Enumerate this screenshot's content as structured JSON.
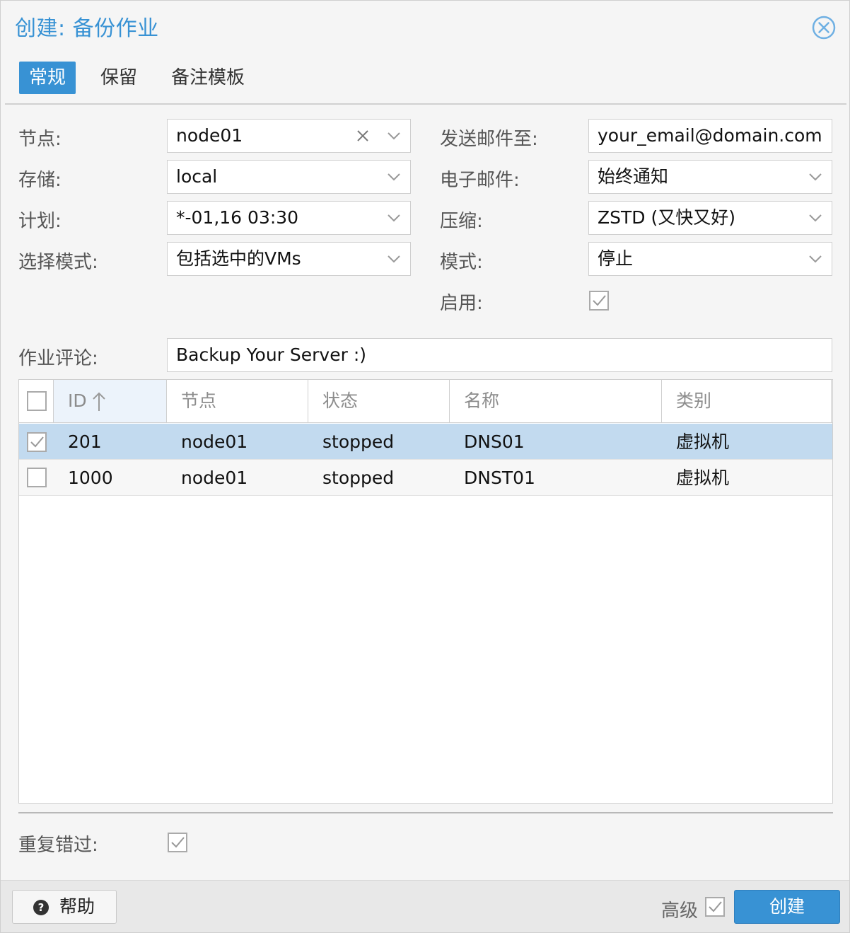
{
  "window": {
    "title": "创建: 备份作业"
  },
  "tabs": [
    {
      "label": "常规",
      "active": true
    },
    {
      "label": "保留",
      "active": false
    },
    {
      "label": "备注模板",
      "active": false
    }
  ],
  "form": {
    "node": {
      "label": "节点:",
      "value": "node01"
    },
    "storage": {
      "label": "存储:",
      "value": "local"
    },
    "schedule": {
      "label": "计划:",
      "value": "*-01,16 03:30"
    },
    "selection_mode": {
      "label": "选择模式:",
      "value": "包括选中的VMs"
    },
    "send_email_to": {
      "label": "发送邮件至:",
      "value": "your_email@domain.com"
    },
    "email": {
      "label": "电子邮件:",
      "value": "始终通知"
    },
    "compression": {
      "label": "压缩:",
      "value": "ZSTD (又快又好)"
    },
    "mode": {
      "label": "模式:",
      "value": "停止"
    },
    "enable": {
      "label": "启用:",
      "checked": true
    },
    "comment": {
      "label": "作业评论:",
      "value": "Backup Your Server :)"
    },
    "repeat_missed": {
      "label": "重复错过:",
      "checked": true
    }
  },
  "grid": {
    "columns": [
      "ID",
      "节点",
      "状态",
      "名称",
      "类别"
    ],
    "sort_column": "ID",
    "sort_direction": "asc",
    "rows": [
      {
        "id": "201",
        "node": "node01",
        "status": "stopped",
        "name": "DNS01",
        "type": "虚拟机",
        "selected": true
      },
      {
        "id": "1000",
        "node": "node01",
        "status": "stopped",
        "name": "DNST01",
        "type": "虚拟机",
        "selected": false
      }
    ]
  },
  "footer": {
    "help_label": "帮助",
    "advanced_label": "高级",
    "advanced_checked": true,
    "create_label": "创建"
  },
  "colors": {
    "accent": "#3892d4",
    "selected_row": "#c2daef",
    "label_text": "#555555",
    "header_text": "#8c8c8c"
  },
  "icons": {
    "close": "close-circle-icon",
    "dropdown": "chevron-down-icon",
    "clear": "clear-x-icon",
    "sort": "sort-ascending-arrow-icon",
    "help": "question-circle-icon",
    "checkbox": "checkbox-icon"
  }
}
